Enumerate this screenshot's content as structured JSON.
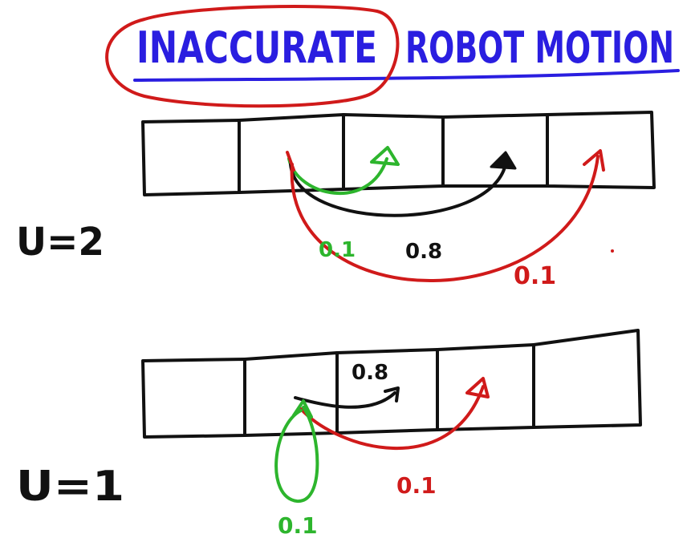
{
  "title": {
    "part1": "INACCURATE",
    "part2": "ROBOT MOTION",
    "color": "#2a1ee0",
    "circle_color": "#d01a1a"
  },
  "rows": [
    {
      "label": "U=2",
      "probs": {
        "green": "0.1",
        "black": "0.8",
        "red": "0.1"
      }
    },
    {
      "label": "U=1",
      "probs": {
        "black": "0.8",
        "red": "0.1",
        "green": "0.1"
      }
    }
  ],
  "colors": {
    "ink": "#111111",
    "green": "#2db52d",
    "red": "#d01a1a",
    "blue": "#2a1ee0"
  }
}
